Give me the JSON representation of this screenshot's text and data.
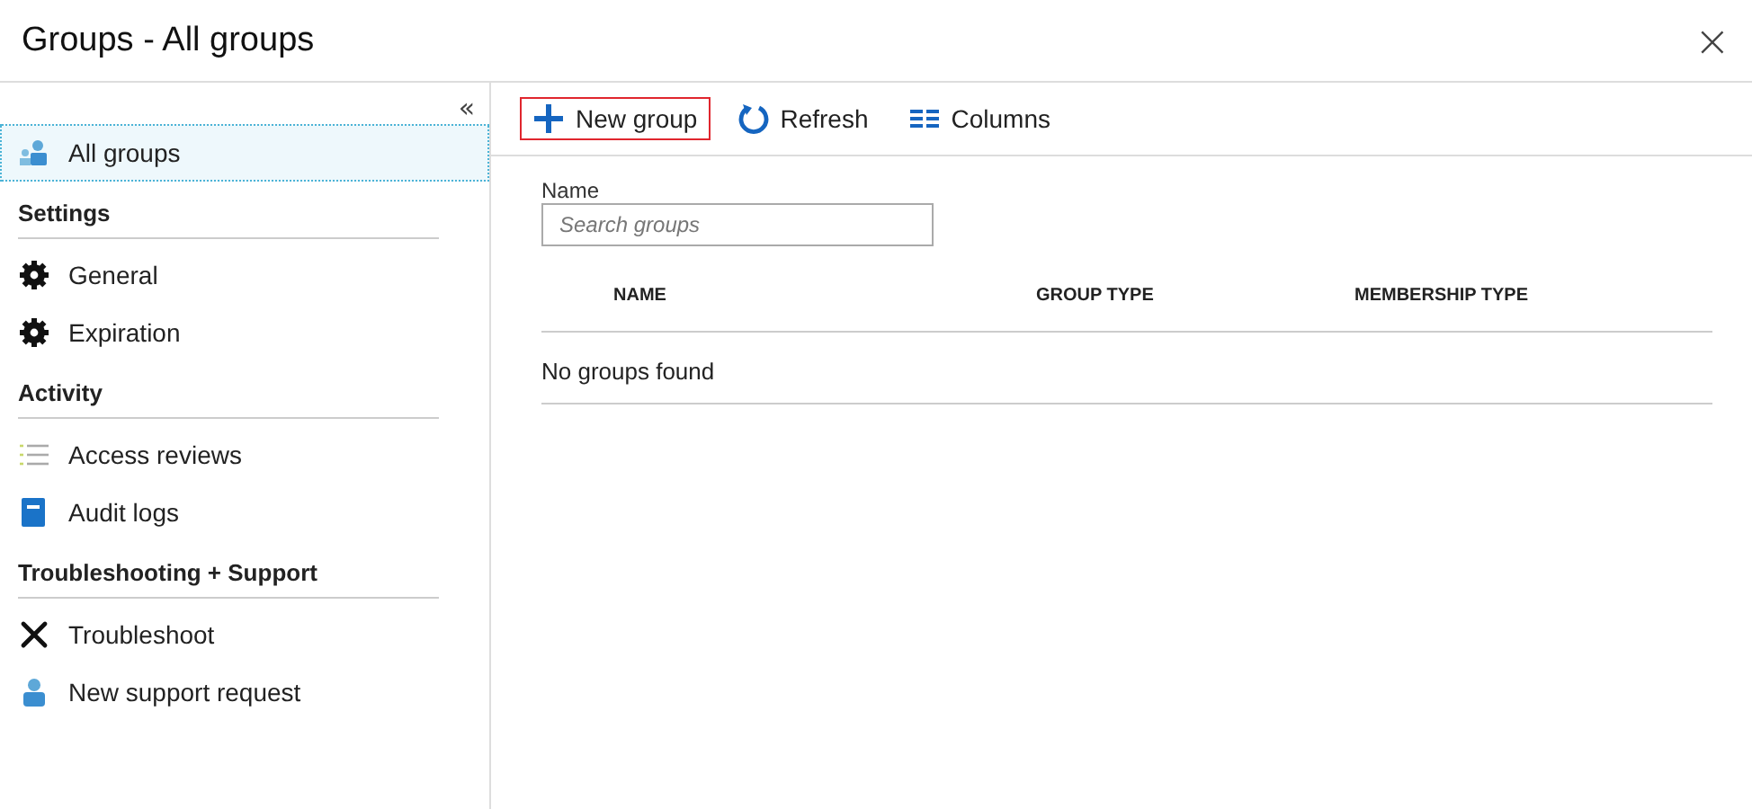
{
  "window": {
    "title": "Groups - All groups",
    "close": "×"
  },
  "sidebar": {
    "collapse": "«",
    "items": [
      {
        "kind": "item",
        "label": "All groups",
        "selected": true
      },
      {
        "kind": "header",
        "label": "Settings"
      },
      {
        "kind": "item",
        "label": "General",
        "selected": false
      },
      {
        "kind": "item",
        "label": "Expiration",
        "selected": false
      },
      {
        "kind": "header",
        "label": "Activity"
      },
      {
        "kind": "item",
        "label": "Access reviews",
        "selected": false
      },
      {
        "kind": "item",
        "label": "Audit logs",
        "selected": false
      },
      {
        "kind": "header",
        "label": "Troubleshooting + Support"
      },
      {
        "kind": "item",
        "label": "Troubleshoot",
        "selected": false
      },
      {
        "kind": "item",
        "label": "New support request",
        "selected": false
      }
    ]
  },
  "toolbar": [
    {
      "label": "New group",
      "highlighted": true
    },
    {
      "label": "Refresh",
      "highlighted": false
    },
    {
      "label": "Columns",
      "highlighted": false
    }
  ],
  "filter": {
    "label": "Name",
    "placeholder": "Search groups"
  },
  "table": {
    "columns": [
      "NAME",
      "GROUP TYPE",
      "MEMBERSHIP TYPE"
    ],
    "empty": "No groups found"
  }
}
